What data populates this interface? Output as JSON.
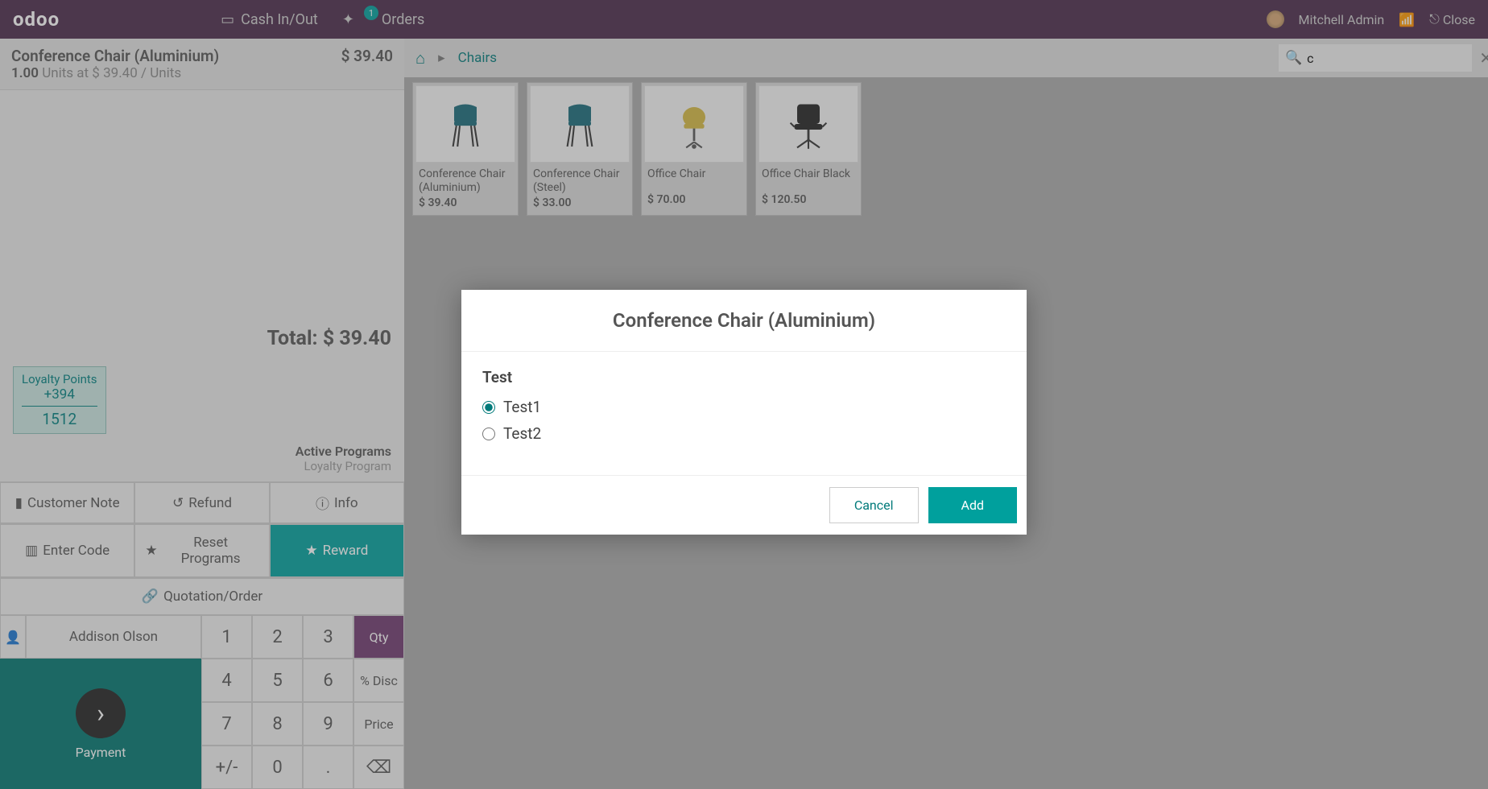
{
  "header": {
    "logo": "odoo",
    "cash_label": "Cash In/Out",
    "orders_label": "Orders",
    "orders_count": "1",
    "user_name": "Mitchell Admin",
    "close_label": "Close"
  },
  "order": {
    "line_name": "Conference Chair (Aluminium)",
    "line_price": "$ 39.40",
    "qty": "1.00",
    "qty_suffix": "Units at $ 39.40 / Units",
    "total_label": "Total: $ 39.40"
  },
  "loyalty": {
    "label": "Loyalty Points",
    "delta": "+394",
    "balance": "1512"
  },
  "programs": {
    "active_label": "Active Programs",
    "program_name": "Loyalty Program"
  },
  "actions": {
    "customer_note": "Customer Note",
    "refund": "Refund",
    "info": "Info",
    "enter_code": "Enter Code",
    "reset_programs": "Reset Programs",
    "reward": "Reward",
    "quotation_order": "Quotation/Order"
  },
  "customer": "Addison Olson",
  "keypad": {
    "k1": "1",
    "k2": "2",
    "k3": "3",
    "qty": "Qty",
    "k4": "4",
    "k5": "5",
    "k6": "6",
    "disc": "% Disc",
    "k7": "7",
    "k8": "8",
    "k9": "9",
    "price": "Price",
    "pm": "+/-",
    "k0": "0",
    "dot": ".",
    "bksp": "⌫"
  },
  "payment_label": "Payment",
  "breadcrumb": {
    "category": "Chairs"
  },
  "search": {
    "query": "c"
  },
  "products": [
    {
      "name": "Conference Chair (Aluminium)",
      "price": "$ 39.40",
      "color": "#1a6b7a"
    },
    {
      "name": "Conference Chair (Steel)",
      "price": "$ 33.00",
      "color": "#1a6b7a"
    },
    {
      "name": "Office Chair",
      "price": "$ 70.00",
      "color": "#d4b843"
    },
    {
      "name": "Office Chair Black",
      "price": "$ 120.50",
      "color": "#222"
    }
  ],
  "modal": {
    "title": "Conference Chair (Aluminium)",
    "group": "Test",
    "options": [
      "Test1",
      "Test2"
    ],
    "cancel": "Cancel",
    "add": "Add"
  }
}
